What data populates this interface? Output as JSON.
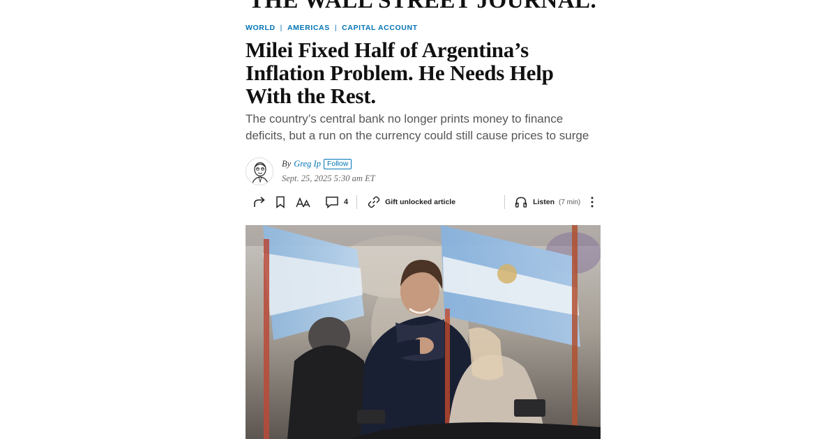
{
  "masthead": {
    "title": "THE WALL STREET JOURNAL."
  },
  "breadcrumb": {
    "items": [
      {
        "label": "WORLD"
      },
      {
        "label": "AMERICAS"
      },
      {
        "label": "CAPITAL ACCOUNT"
      }
    ],
    "separator": "|"
  },
  "article": {
    "headline": "Milei Fixed Half of Argentina’s Inflation Problem. He Needs Help With the Rest.",
    "dek": "The country’s central bank no longer prints money to finance deficits, but a run on the currency could still cause prices to surge"
  },
  "byline": {
    "prefix": "By",
    "author": "Greg Ip",
    "follow_label": "Follow",
    "timestamp": "Sept. 25, 2025 5:30 am ET"
  },
  "toolbar": {
    "share_icon": "share-icon",
    "bookmark_icon": "bookmark-icon",
    "text_size_icon": "text-size-icon",
    "comments_icon": "comment-icon",
    "comments_count": "4",
    "gift_icon": "link-icon",
    "gift_label": "Gift unlocked article",
    "listen_icon": "headphones-icon",
    "listen_label": "Listen",
    "listen_duration": "(7 min)",
    "more_icon": "more-vertical-icon"
  },
  "colors": {
    "accent": "#0274b6",
    "headline": "#111111",
    "dek": "#555555"
  }
}
